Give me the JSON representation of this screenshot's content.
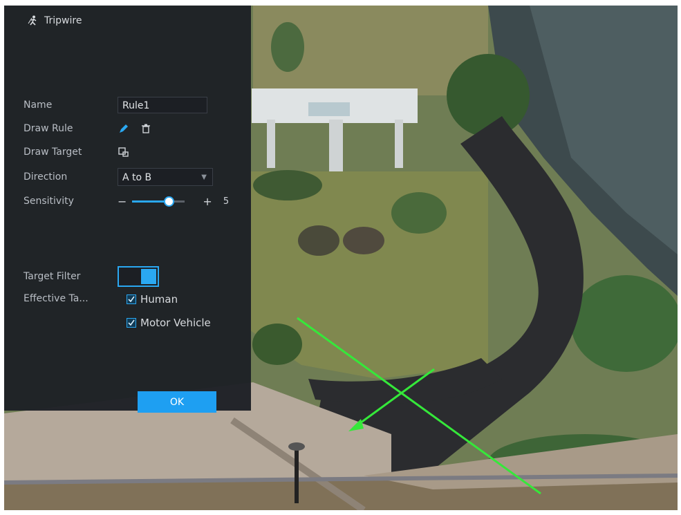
{
  "panel": {
    "title": "Tripwire",
    "title_icon": "tripwire-person-icon",
    "ok_label": "OK"
  },
  "fields": {
    "name_label": "Name",
    "name_value": "Rule1",
    "draw_rule_label": "Draw Rule",
    "draw_target_label": "Draw Target",
    "direction_label": "Direction",
    "direction_value": "A to B",
    "sensitivity_label": "Sensitivity",
    "sensitivity_value": "5",
    "target_filter_label": "Target Filter",
    "target_filter_on": true,
    "effective_target_label": "Effective Ta...",
    "targets": [
      {
        "label": "Human",
        "checked": true
      },
      {
        "label": "Motor Vehicle",
        "checked": true
      }
    ]
  },
  "icons": {
    "draw_rule": "pencil-icon",
    "clear_rule": "trash-icon",
    "draw_target": "target-box-icon"
  },
  "colors": {
    "accent": "#1e9ff2",
    "tripwire_line": "#35e83a",
    "panel_bg": "#1e2126"
  }
}
